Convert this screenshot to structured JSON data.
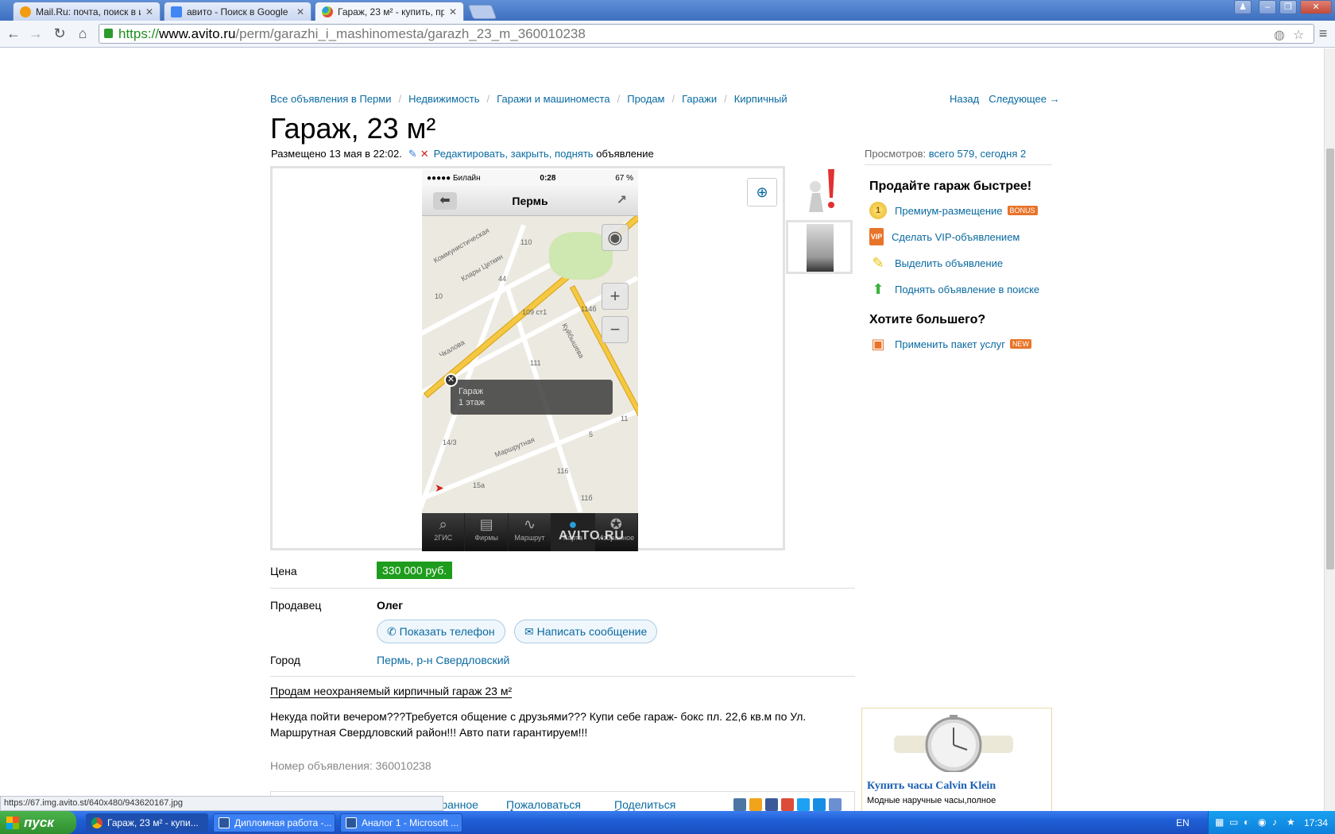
{
  "browser": {
    "tabs": [
      {
        "title": "Mail.Ru: почта, поиск в инте",
        "favicon_color": "#f39c12"
      },
      {
        "title": "авито - Поиск в Google",
        "favicon_color": "#4285f4"
      },
      {
        "title": "Гараж, 23 м² - купить, про",
        "favicon_color": "#2a9fd8"
      }
    ],
    "url_scheme": "https://",
    "url_host": "www.avito.ru",
    "url_path": "/perm/garazhi_i_mashinomesta/garazh_23_m_360010238"
  },
  "breadcrumbs": [
    "Все объявления в Перми",
    "Недвижимость",
    "Гаражи и машиноместа",
    "Продам",
    "Гаражи",
    "Кирпичный"
  ],
  "pager": {
    "back": "Назад",
    "next": "Следующее →"
  },
  "title": "Гараж, 23 м²",
  "posted": {
    "text": "Размещено 13 мая в 22:02.",
    "actions": "Редактировать, закрыть, поднять",
    "suffix": "объявление"
  },
  "gallery": {
    "status_carrier": "●●●●● Билайн",
    "status_time": "0:28",
    "status_battery": "67 %",
    "nav_title": "Пермь",
    "popup_line1": "Гараж",
    "popup_line2": "1 этаж",
    "map_labels": [
      "Коммунистическая",
      "Клары Цеткин",
      "110",
      "44",
      "10",
      "109 ст1",
      "114б",
      "Чкалова",
      "Куйбышева",
      "111",
      "14/3",
      "Маршрутная",
      "116",
      "5",
      "15а",
      "11",
      "11б"
    ],
    "tabs": [
      "2ГИС",
      "Фирмы",
      "Маршрут",
      "Карта",
      "Избранное"
    ],
    "watermark": "AVITO.RU"
  },
  "details": {
    "price_label": "Цена",
    "price": "330 000 руб.",
    "seller_label": "Продавец",
    "seller": "Олег",
    "show_phone": "Показать телефон",
    "write_message": "Написать сообщение",
    "city_label": "Город",
    "city": "Пермь, р-н Свердловский"
  },
  "description": {
    "title": "Продам неохраняемый кирпичный гараж 23 м²",
    "text": "Некуда пойти вечером???Требуется общение с друзьями??? Купи себе гараж- бокс пл. 22,6 кв.м по Ул. Маршрутная Свердловский район!!! Авто пати гарантируем!!!",
    "ad_number": "Номер объявления: 360010238"
  },
  "bottom_actions": {
    "favorite": "Избранное",
    "complain": "Пожаловаться",
    "share": "Поделиться"
  },
  "sidebar": {
    "views_label": "Просмотров:",
    "views_value": "всего 579, сегодня 2",
    "sell_faster": "Продайте гараж быстрее!",
    "services": [
      {
        "label": "Премиум-размещение",
        "badge": "BONUS"
      },
      {
        "label": "Сделать VIP-объявлением"
      },
      {
        "label": "Выделить объявление"
      },
      {
        "label": "Поднять объявление в поиске"
      }
    ],
    "want_more": "Хотите большего?",
    "package": {
      "label": "Применить пакет услуг",
      "badge": "NEW"
    },
    "ad_title": "Купить часы Calvin Klein",
    "ad_subtitle": "Модные наручные часы,полное"
  },
  "status_url": "https://67.img.avito.st/640x480/943620167.jpg",
  "taskbar": {
    "start": "пуск",
    "tasks": [
      "Гараж, 23 м² - купи...",
      "Дипломная работа -...",
      "Аналог 1 - Microsoft ..."
    ],
    "lang": "EN",
    "clock": "17:34"
  },
  "colors": {
    "link": "#0a6aa1",
    "price_bg": "#1e9c1e",
    "bonus": "#e8742a",
    "new": "#e8742a"
  }
}
